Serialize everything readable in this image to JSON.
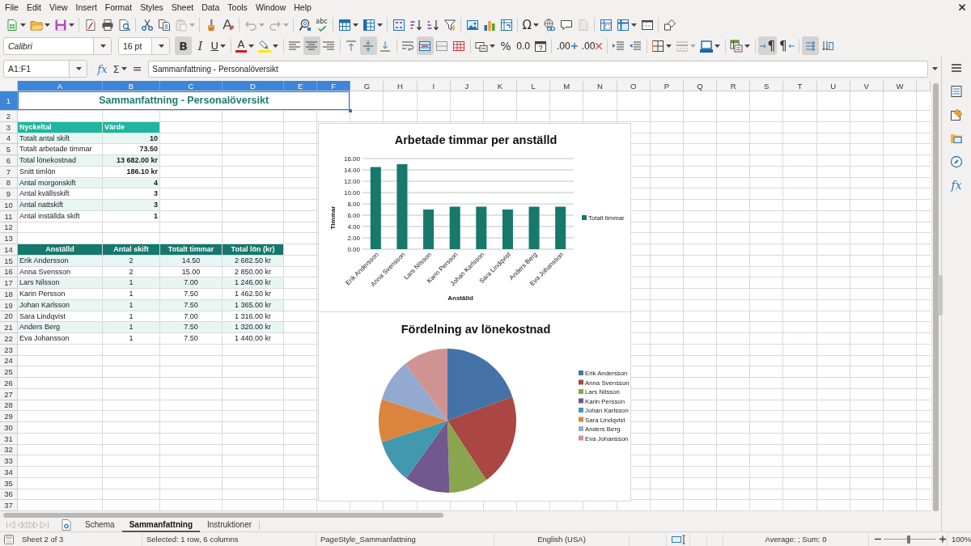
{
  "menu_bar": {
    "items": [
      "File",
      "Edit",
      "View",
      "Insert",
      "Format",
      "Styles",
      "Sheet",
      "Data",
      "Tools",
      "Window",
      "Help"
    ]
  },
  "standard_toolbar": [
    [
      {
        "kind": "new",
        "dropdown": true,
        "disabled": false
      },
      {
        "kind": "open",
        "dropdown": true,
        "disabled": false
      },
      {
        "kind": "save",
        "dropdown": true,
        "disabled": false
      }
    ],
    [
      {
        "kind": "pdf",
        "dropdown": false,
        "disabled": false
      },
      {
        "kind": "print",
        "dropdown": false,
        "disabled": false
      },
      {
        "kind": "preview",
        "dropdown": false,
        "disabled": false
      }
    ],
    [
      {
        "kind": "cut",
        "dropdown": false,
        "disabled": false
      },
      {
        "kind": "copy",
        "dropdown": false,
        "disabled": false
      },
      {
        "kind": "paste",
        "dropdown": true,
        "disabled": true
      }
    ],
    [
      {
        "kind": "clone",
        "dropdown": false,
        "disabled": false
      },
      {
        "kind": "clear",
        "dropdown": false,
        "disabled": false
      }
    ],
    [
      {
        "kind": "undo",
        "dropdown": true,
        "disabled": true
      },
      {
        "kind": "redo",
        "dropdown": true,
        "disabled": true
      }
    ],
    [
      {
        "kind": "find",
        "dropdown": false,
        "disabled": false
      },
      {
        "kind": "spelling",
        "glyph": "abc",
        "dropdown": false,
        "disabled": false
      }
    ],
    [
      {
        "kind": "rows",
        "dropdown": true,
        "disabled": false
      },
      {
        "kind": "columns",
        "dropdown": true,
        "disabled": false
      }
    ],
    [
      {
        "kind": "sort",
        "dropdown": false,
        "disabled": false
      },
      {
        "kind": "sortasc",
        "dropdown": false,
        "disabled": false
      },
      {
        "kind": "sortdesc",
        "dropdown": false,
        "disabled": false
      },
      {
        "kind": "filter",
        "dropdown": false,
        "disabled": false
      }
    ],
    [
      {
        "kind": "image",
        "dropdown": false,
        "disabled": false
      },
      {
        "kind": "chart",
        "dropdown": false,
        "disabled": false
      },
      {
        "kind": "pivot",
        "dropdown": false,
        "disabled": false
      }
    ],
    [
      {
        "kind": "special",
        "glyph": "Ω",
        "dropdown": true,
        "disabled": false
      },
      {
        "kind": "hyperlink",
        "dropdown": false,
        "disabled": false
      },
      {
        "kind": "comment",
        "dropdown": false,
        "disabled": false
      },
      {
        "kind": "header",
        "dropdown": false,
        "disabled": true
      }
    ],
    [
      {
        "kind": "printarea",
        "dropdown": false,
        "disabled": false
      },
      {
        "kind": "freeze",
        "dropdown": true,
        "disabled": false
      },
      {
        "kind": "split",
        "dropdown": false,
        "disabled": false
      }
    ],
    [
      {
        "kind": "shapes",
        "dropdown": false,
        "disabled": false
      }
    ]
  ],
  "formatting_toolbar": {
    "font_name": "Calibri",
    "font_size": "16 pt",
    "groups": [
      [
        {
          "kind": "bold",
          "glyph": "B",
          "on": true,
          "dropdown": false,
          "disabled": false
        },
        {
          "kind": "italic",
          "glyph": "I",
          "on": false,
          "dropdown": false,
          "disabled": false
        },
        {
          "kind": "underline",
          "glyph": "U",
          "on": false,
          "dropdown": true,
          "disabled": false
        }
      ],
      [
        {
          "kind": "fontcolor",
          "glyph": "A",
          "on": false,
          "dropdown": true,
          "disabled": false
        },
        {
          "kind": "highlight",
          "on": false,
          "dropdown": true,
          "disabled": false
        }
      ],
      [
        {
          "kind": "alignleft",
          "on": false,
          "dropdown": false,
          "disabled": false
        },
        {
          "kind": "aligncenter",
          "on": true,
          "dropdown": false,
          "disabled": false
        },
        {
          "kind": "alignright",
          "on": false,
          "dropdown": false,
          "disabled": false
        }
      ],
      [
        {
          "kind": "aligntop",
          "on": false,
          "dropdown": false,
          "disabled": false
        },
        {
          "kind": "alignmiddle",
          "on": true,
          "dropdown": false,
          "disabled": false
        },
        {
          "kind": "alignbottom",
          "on": false,
          "dropdown": false,
          "disabled": false
        }
      ],
      [
        {
          "kind": "wrap",
          "on": false,
          "dropdown": false,
          "disabled": false
        },
        {
          "kind": "mergecenter",
          "on": true,
          "dropdown": false,
          "disabled": false
        },
        {
          "kind": "merge",
          "on": false,
          "dropdown": false,
          "disabled": false
        },
        {
          "kind": "unmerge",
          "on": false,
          "dropdown": false,
          "disabled": false
        }
      ],
      [
        {
          "kind": "currency",
          "on": false,
          "dropdown": true,
          "disabled": false
        },
        {
          "kind": "percent",
          "glyph": "%",
          "on": false,
          "dropdown": false,
          "disabled": false
        },
        {
          "kind": "number",
          "glyph": "0.0",
          "on": false,
          "dropdown": false,
          "disabled": false
        },
        {
          "kind": "date",
          "on": false,
          "dropdown": false,
          "disabled": false
        }
      ],
      [
        {
          "kind": "adddecimal",
          "glyph": ".00",
          "on": false,
          "dropdown": false,
          "disabled": false
        },
        {
          "kind": "deletedecimal",
          "glyph": ".00",
          "on": false,
          "dropdown": false,
          "disabled": false
        }
      ],
      [
        {
          "kind": "indent",
          "on": false,
          "dropdown": false,
          "disabled": false
        },
        {
          "kind": "outdent",
          "on": false,
          "dropdown": false,
          "disabled": false
        }
      ],
      [
        {
          "kind": "borders",
          "on": false,
          "dropdown": true,
          "disabled": false
        },
        {
          "kind": "borderstyle",
          "on": false,
          "dropdown": true,
          "disabled": true
        },
        {
          "kind": "bordercolor",
          "on": false,
          "dropdown": true,
          "disabled": false
        }
      ],
      [
        {
          "kind": "conditional",
          "on": false,
          "dropdown": true,
          "disabled": false
        }
      ],
      [
        {
          "kind": "ltr",
          "glyph": "¶",
          "on": true,
          "dropdown": false,
          "disabled": false
        },
        {
          "kind": "rtl",
          "glyph": "¶",
          "on": false,
          "dropdown": false,
          "disabled": false
        }
      ],
      [
        {
          "kind": "stacked",
          "on": true,
          "dropdown": false,
          "disabled": false
        },
        {
          "kind": "vertical",
          "on": false,
          "dropdown": false,
          "disabled": false
        }
      ]
    ]
  },
  "formula_bar": {
    "name_box": "A1:F1",
    "function_wizard": "fx",
    "sum": "Σ",
    "formula": "=",
    "content": "Sammanfattning - Personalöversikt"
  },
  "sheet": {
    "title": "Sammanfattning - Personalöversikt",
    "key_figures": {
      "columns": [
        "Nyckeltal",
        "Värde"
      ],
      "rows": [
        [
          "Totalt antal skift",
          "10"
        ],
        [
          "Totalt arbetade timmar",
          "73.50"
        ],
        [
          "Total lönekostnad",
          "13 682.00 kr"
        ],
        [
          "Snitt timlön",
          "186.10 kr"
        ],
        [
          "Antal morgonskift",
          "4"
        ],
        [
          "Antal kvällsskift",
          "3"
        ],
        [
          "Antal nattskift",
          "3"
        ],
        [
          "Antal inställda skift",
          "1"
        ]
      ]
    },
    "employees": {
      "columns": [
        "Anställd",
        "Antal skift",
        "Totalt timmar",
        "Total lön (kr)"
      ],
      "rows": [
        [
          "Erik Andersson",
          "2",
          "14.50",
          "2 682.50 kr"
        ],
        [
          "Anna Svensson",
          "2",
          "15.00",
          "2 850.00 kr"
        ],
        [
          "Lars Nilsson",
          "1",
          "7.00",
          "1 246.00 kr"
        ],
        [
          "Karin Persson",
          "1",
          "7.50",
          "1 462.50 kr"
        ],
        [
          "Johan Karlsson",
          "1",
          "7.50",
          "1 365.00 kr"
        ],
        [
          "Sara Lindqvist",
          "1",
          "7.00",
          "1 316.00 kr"
        ],
        [
          "Anders Berg",
          "1",
          "7.50",
          "1 320.00 kr"
        ],
        [
          "Eva Johansson",
          "1",
          "7.50",
          "1 440.00 kr"
        ]
      ]
    },
    "columns": [
      {
        "label": "A",
        "selected": true
      },
      {
        "label": "B",
        "selected": true
      },
      {
        "label": "C",
        "selected": true
      },
      {
        "label": "D",
        "selected": true
      },
      {
        "label": "E",
        "selected": true
      },
      {
        "label": "F",
        "selected": true
      },
      {
        "label": "G",
        "selected": false
      },
      {
        "label": "H",
        "selected": false
      },
      {
        "label": "I",
        "selected": false
      },
      {
        "label": "J",
        "selected": false
      },
      {
        "label": "K",
        "selected": false
      },
      {
        "label": "L",
        "selected": false
      },
      {
        "label": "M",
        "selected": false
      },
      {
        "label": "N",
        "selected": false
      },
      {
        "label": "O",
        "selected": false
      },
      {
        "label": "P",
        "selected": false
      },
      {
        "label": "Q",
        "selected": false
      },
      {
        "label": "R",
        "selected": false
      },
      {
        "label": "S",
        "selected": false
      },
      {
        "label": "T",
        "selected": false
      },
      {
        "label": "U",
        "selected": false
      },
      {
        "label": "V",
        "selected": false
      },
      {
        "label": "W",
        "selected": false
      }
    ],
    "rows": [
      {
        "label": "1",
        "selected": true
      },
      {
        "label": "2",
        "selected": false
      },
      {
        "label": "3",
        "selected": false
      },
      {
        "label": "4",
        "selected": false
      },
      {
        "label": "5",
        "selected": false
      },
      {
        "label": "6",
        "selected": false
      },
      {
        "label": "7",
        "selected": false
      },
      {
        "label": "8",
        "selected": false
      },
      {
        "label": "9",
        "selected": false
      },
      {
        "label": "10",
        "selected": false
      },
      {
        "label": "11",
        "selected": false
      },
      {
        "label": "12",
        "selected": false
      },
      {
        "label": "13",
        "selected": false
      },
      {
        "label": "14",
        "selected": false
      },
      {
        "label": "15",
        "selected": false
      },
      {
        "label": "16",
        "selected": false
      },
      {
        "label": "17",
        "selected": false
      },
      {
        "label": "18",
        "selected": false
      },
      {
        "label": "19",
        "selected": false
      },
      {
        "label": "20",
        "selected": false
      },
      {
        "label": "21",
        "selected": false
      },
      {
        "label": "22",
        "selected": false
      },
      {
        "label": "23",
        "selected": false
      },
      {
        "label": "24",
        "selected": false
      },
      {
        "label": "25",
        "selected": false
      },
      {
        "label": "26",
        "selected": false
      },
      {
        "label": "27",
        "selected": false
      },
      {
        "label": "28",
        "selected": false
      },
      {
        "label": "29",
        "selected": false
      },
      {
        "label": "30",
        "selected": false
      },
      {
        "label": "31",
        "selected": false
      },
      {
        "label": "32",
        "selected": false
      },
      {
        "label": "33",
        "selected": false
      },
      {
        "label": "34",
        "selected": false
      },
      {
        "label": "35",
        "selected": false
      },
      {
        "label": "36",
        "selected": false
      },
      {
        "label": "37",
        "selected": false
      }
    ]
  },
  "bar_chart": {
    "chart_data": {
      "type": "bar",
      "title": "Arbetade timmar per anställd",
      "xlabel": "Anställd",
      "ylabel": "Timmar",
      "categories": [
        "Erik Andersson",
        "Anna Svensson",
        "Lars Nilsson",
        "Karin Persson",
        "Johan Karlsson",
        "Sara Lindqvist",
        "Anders Berg",
        "Eva Johansson"
      ],
      "series": [
        {
          "name": "Totalt timmar",
          "color": "#17786c",
          "values": [
            14.5,
            15,
            7,
            7.5,
            7.5,
            7,
            7.5,
            7.5
          ]
        }
      ],
      "ylim": [
        0,
        16
      ],
      "yticks": [
        {
          "value": 0,
          "label": "0.00"
        },
        {
          "value": 2,
          "label": "2.00"
        },
        {
          "value": 4,
          "label": "4.00"
        },
        {
          "value": 6,
          "label": "6.00"
        },
        {
          "value": 8,
          "label": "8.00"
        },
        {
          "value": 10,
          "label": "10.00"
        },
        {
          "value": 12,
          "label": "12.00"
        },
        {
          "value": 14,
          "label": "14.00"
        },
        {
          "value": 16,
          "label": "16.00"
        }
      ],
      "grid": true,
      "legend": "right"
    }
  },
  "pie_chart": {
    "chart_data": {
      "type": "pie",
      "title": "Fördelning av lönekostnad",
      "categories": [
        "Erik Andersson",
        "Anna Svensson",
        "Lars Nilsson",
        "Karin Persson",
        "Johan Karlsson",
        "Sara Lindqvist",
        "Anders Berg",
        "Eva Johansson"
      ],
      "values": [
        19.6,
        20.83,
        9.11,
        10.69,
        9.98,
        9.62,
        9.65,
        10.52
      ],
      "colors": [
        "#4572a7",
        "#aa4643",
        "#89a54e",
        "#71588f",
        "#4198af",
        "#db843d",
        "#93a9cf",
        "#d19392"
      ],
      "legend": "right"
    }
  },
  "sidebar": {
    "decks": [
      {
        "kind": "menu"
      },
      {
        "kind": "properties"
      },
      {
        "kind": "styles"
      },
      {
        "kind": "gallery"
      },
      {
        "kind": "navigator"
      },
      {
        "kind": "functions",
        "glyph": "fx"
      }
    ]
  },
  "sheet_tabs": [
    {
      "label": "Schema",
      "selected": false
    },
    {
      "label": "Sammanfattning",
      "selected": true
    },
    {
      "label": "Instruktioner",
      "selected": false
    }
  ],
  "status_bar": {
    "sheet_position": "Sheet 2 of 3",
    "selection": "Selected: 1 row, 6 columns",
    "page_style": "PageStyle_Sammanfattning",
    "language": "English (USA)",
    "statistics": "Average: ; Sum: 0",
    "zoom": {
      "level": 0.48,
      "reading": "100%"
    }
  }
}
